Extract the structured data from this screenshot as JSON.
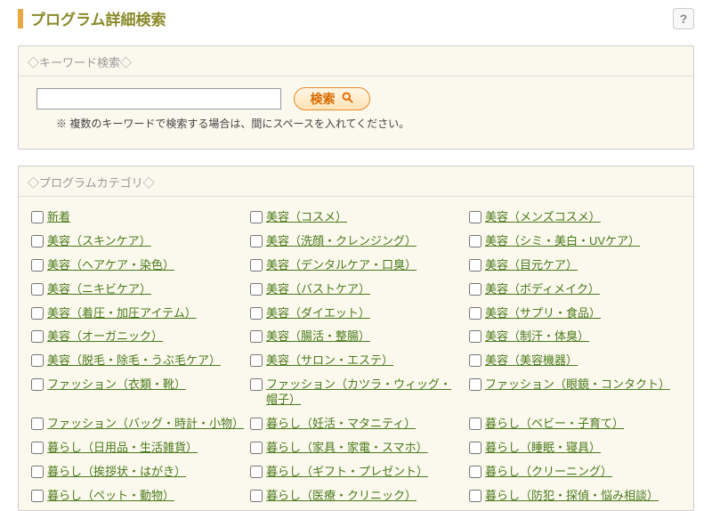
{
  "page_title": "プログラム詳細検索",
  "help_tooltip": "ヘルプ",
  "keyword_section": {
    "header": "◇キーワード検索◇",
    "input_value": "",
    "input_placeholder": "",
    "search_button": "検索",
    "note": "※ 複数のキーワードで検索する場合は、間にスペースを入れてください。"
  },
  "category_section": {
    "header": "◇プログラムカテゴリ◇",
    "items": [
      {
        "label": "新着"
      },
      {
        "label": "美容（コスメ）"
      },
      {
        "label": "美容（メンズコスメ）"
      },
      {
        "label": "美容（スキンケア）"
      },
      {
        "label": "美容（洗顔・クレンジング）"
      },
      {
        "label": "美容（シミ・美白・UVケア）"
      },
      {
        "label": "美容（ヘアケア・染色）"
      },
      {
        "label": "美容（デンタルケア・口臭）"
      },
      {
        "label": "美容（目元ケア）"
      },
      {
        "label": "美容（ニキビケア）"
      },
      {
        "label": "美容（バストケア）"
      },
      {
        "label": "美容（ボディメイク）"
      },
      {
        "label": "美容（着圧・加圧アイテム）"
      },
      {
        "label": "美容（ダイエット）"
      },
      {
        "label": "美容（サプリ・食品）"
      },
      {
        "label": "美容（オーガニック）"
      },
      {
        "label": "美容（腸活・整腸）"
      },
      {
        "label": "美容（制汗・体臭）"
      },
      {
        "label": "美容（脱毛・除毛・うぶ毛ケア）"
      },
      {
        "label": "美容（サロン・エステ）"
      },
      {
        "label": "美容（美容機器）"
      },
      {
        "label": "ファッション（衣類・靴）"
      },
      {
        "label": "ファッション（カツラ・ウィッグ・帽子）"
      },
      {
        "label": "ファッション（眼鏡・コンタクト）"
      },
      {
        "label": "ファッション（バッグ・時計・小物）"
      },
      {
        "label": "暮らし（妊活・マタニティ）"
      },
      {
        "label": "暮らし（ベビー・子育て）"
      },
      {
        "label": "暮らし（日用品・生活雑貨）"
      },
      {
        "label": "暮らし（家具・家電・スマホ）"
      },
      {
        "label": "暮らし（睡眠・寝具）"
      },
      {
        "label": "暮らし（挨拶状・はがき）"
      },
      {
        "label": "暮らし（ギフト・プレゼント）"
      },
      {
        "label": "暮らし（クリーニング）"
      },
      {
        "label": "暮らし（ペット・動物）"
      },
      {
        "label": "暮らし（医療・クリニック）"
      },
      {
        "label": "暮らし（防犯・探偵・悩み相談）"
      }
    ]
  }
}
